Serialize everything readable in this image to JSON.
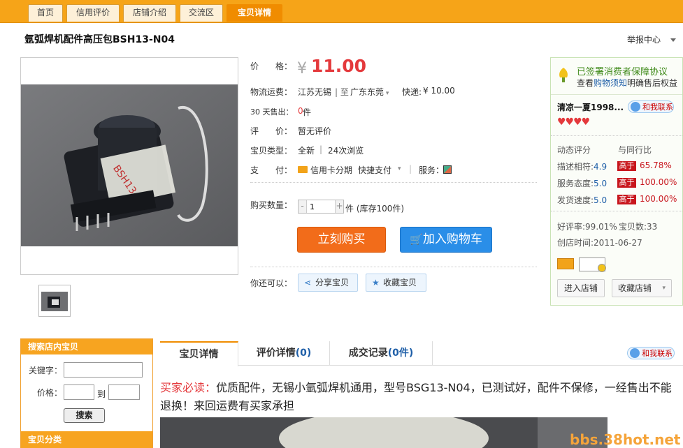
{
  "nav": {
    "tabs": [
      "首页",
      "信用评价",
      "店铺介绍",
      "交流区",
      "宝贝详情"
    ]
  },
  "item": {
    "title": "氩弧焊机配件高压包BSH13-N04",
    "report": "举报中心",
    "price_label": "价　　格：",
    "currency": "¥",
    "price": "11.00",
    "shipping_label": "物流运费：",
    "from": "江苏无锡",
    "to_sep": "| 至",
    "to": "广东东莞",
    "express": "快递:",
    "express_price": "¥ 10.00",
    "sold_label": "30 天售出：",
    "sold": "0",
    "sold_unit": "件",
    "rating_label": "评　　价：",
    "rating": "暂无评价",
    "type_label": "宝贝类型：",
    "type": "全新",
    "views": "24次浏览",
    "pay_label": "支　　付：",
    "pay_credit": "信用卡分期",
    "pay_quick": "快捷支付",
    "service_label": "服务：",
    "qty_label": "购买数量：",
    "qty_minus": "-",
    "qty_plus": "+",
    "qty": "1",
    "stock": "件 (库存100件)",
    "buy": "立刻购买",
    "cart": "加入购物车",
    "can_label": "你还可以：",
    "share": "分享宝贝",
    "fav": "收藏宝贝"
  },
  "shop": {
    "guarantee": "已签署消费者保障协议",
    "guarantee_sub_1": "查看",
    "guarantee_link": "购物须知",
    "guarantee_sub_2": "明确售后权益",
    "seller": "清凉一夏1998...",
    "contact": "和我联系",
    "dyn_label": "动态评分",
    "cmp_label": "与同行比",
    "rows": [
      {
        "label": "描述相符:",
        "score": "4.9",
        "cmp": "高于",
        "pct": "65.78%"
      },
      {
        "label": "服务态度:",
        "score": "5.0",
        "cmp": "高于",
        "pct": "100.00%"
      },
      {
        "label": "发货速度:",
        "score": "5.0",
        "cmp": "高于",
        "pct": "100.00%"
      }
    ],
    "good_rate": "好评率:99.01%",
    "item_count": "宝贝数:33",
    "created": "创店时间:2011-06-27",
    "enter": "进入店铺",
    "collect": "收藏店铺"
  },
  "left": {
    "search_title": "搜索店内宝贝",
    "kw_label": "关键字：",
    "price_label": "价格：",
    "to": "到",
    "search": "搜索",
    "cat_title": "宝贝分类"
  },
  "detail": {
    "tabs": [
      {
        "label": "宝贝详情",
        "num": ""
      },
      {
        "label": "评价详情",
        "num": "(0)"
      },
      {
        "label": "成交记录",
        "num": "(0件)"
      }
    ],
    "contact": "和我联系",
    "must": "买家必读：",
    "text": "优质配件，无锡小氩弧焊机通用，型号BSG13-N04，已测试好，配件不保修，一经售出不能退换！来回运费有买家承担",
    "watermark": "bbs.38hot.net"
  },
  "colors": {
    "accent": "#f6a418",
    "price": "#e4393c",
    "buy": "#f26c1a",
    "cart": "#2a8ee8"
  }
}
